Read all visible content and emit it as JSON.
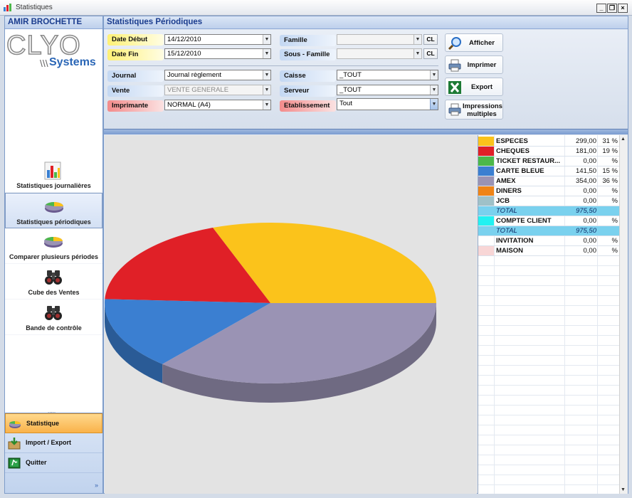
{
  "window": {
    "title": "Statistiques"
  },
  "sidebar": {
    "user": "AMIR BROCHETTE",
    "logo_text": "CLYO",
    "logo_sub": "Systems",
    "items": [
      {
        "label": "Statistiques journalières",
        "icon": "bar-chart-icon"
      },
      {
        "label": "Statistiques périodiques",
        "icon": "pie-chart-icon",
        "active": true
      },
      {
        "label": "Comparer plusieurs périodes",
        "icon": "pie-chart-icon"
      },
      {
        "label": "Cube des Ventes",
        "icon": "binoculars-icon"
      },
      {
        "label": "Bande de contrôle",
        "icon": "binoculars-icon"
      }
    ],
    "dots": ".....",
    "bottom": [
      {
        "label": "Statistique",
        "icon": "pie-chart-icon",
        "active": true
      },
      {
        "label": "Import / Export",
        "icon": "import-export-icon"
      },
      {
        "label": "Quitter",
        "icon": "exit-icon"
      }
    ],
    "expand": "»"
  },
  "main": {
    "title": "Statistiques Périodiques",
    "filters": {
      "date_debut": {
        "label": "Date Début",
        "value": "14/12/2010"
      },
      "date_fin": {
        "label": "Date Fin",
        "value": "15/12/2010"
      },
      "famille": {
        "label": "Famille",
        "value": ""
      },
      "sous_famille": {
        "label": "Sous - Famille",
        "value": ""
      },
      "journal": {
        "label": "Journal",
        "value": "Journal règlement"
      },
      "vente": {
        "label": "Vente",
        "value": "VENTE GENERALE"
      },
      "imprimante": {
        "label": "Imprimante",
        "value": "NORMAL (A4)"
      },
      "caisse": {
        "label": "Caisse",
        "value": "_TOUT"
      },
      "serveur": {
        "label": "Serveur",
        "value": "_TOUT"
      },
      "etablissement": {
        "label": "Etablissement",
        "value": "Tout"
      },
      "cl_label": "CL"
    },
    "actions": {
      "afficher": "Afficher",
      "imprimer": "Imprimer",
      "export": "Export",
      "impressions": "Impressions multiples"
    }
  },
  "legend": [
    {
      "name": "ESPECES",
      "value": "299,00",
      "pct": "31 %",
      "color": "#fbc31b"
    },
    {
      "name": "CHEQUES",
      "value": "181,00",
      "pct": "19 %",
      "color": "#e02027"
    },
    {
      "name": "TICKET RESTAUR...",
      "value": "0,00",
      "pct": "%",
      "color": "#4cb84a"
    },
    {
      "name": "CARTE BLEUE",
      "value": "141,50",
      "pct": "15 %",
      "color": "#3b7fd1"
    },
    {
      "name": "AMEX",
      "value": "354,00",
      "pct": "36 %",
      "color": "#9a93b4"
    },
    {
      "name": "DINERS",
      "value": "0,00",
      "pct": "%",
      "color": "#ef8417"
    },
    {
      "name": "JCB",
      "value": "0,00",
      "pct": "%",
      "color": "#9fc1c8"
    },
    {
      "name": "TOTAL",
      "value": "975,50",
      "pct": "",
      "color": "#7ad1ee",
      "total": true
    },
    {
      "name": "COMPTE CLIENT",
      "value": "0,00",
      "pct": "%",
      "color": "#22f1f1"
    },
    {
      "name": "TOTAL",
      "value": "975,50",
      "pct": "",
      "color": "#7ad1ee",
      "total": true
    },
    {
      "name": "INVITATION",
      "value": "0,00",
      "pct": "%",
      "color": "#ffffff"
    },
    {
      "name": "MAISON",
      "value": "0,00",
      "pct": "%",
      "color": "#f8d6d6"
    }
  ],
  "chart_data": {
    "type": "pie",
    "categories": [
      "ESPECES",
      "CHEQUES",
      "CARTE BLEUE",
      "AMEX"
    ],
    "values": [
      299.0,
      181.0,
      141.5,
      354.0
    ],
    "colors": [
      "#fbc31b",
      "#e02027",
      "#3b7fd1",
      "#9a93b4"
    ],
    "style": "3d"
  }
}
